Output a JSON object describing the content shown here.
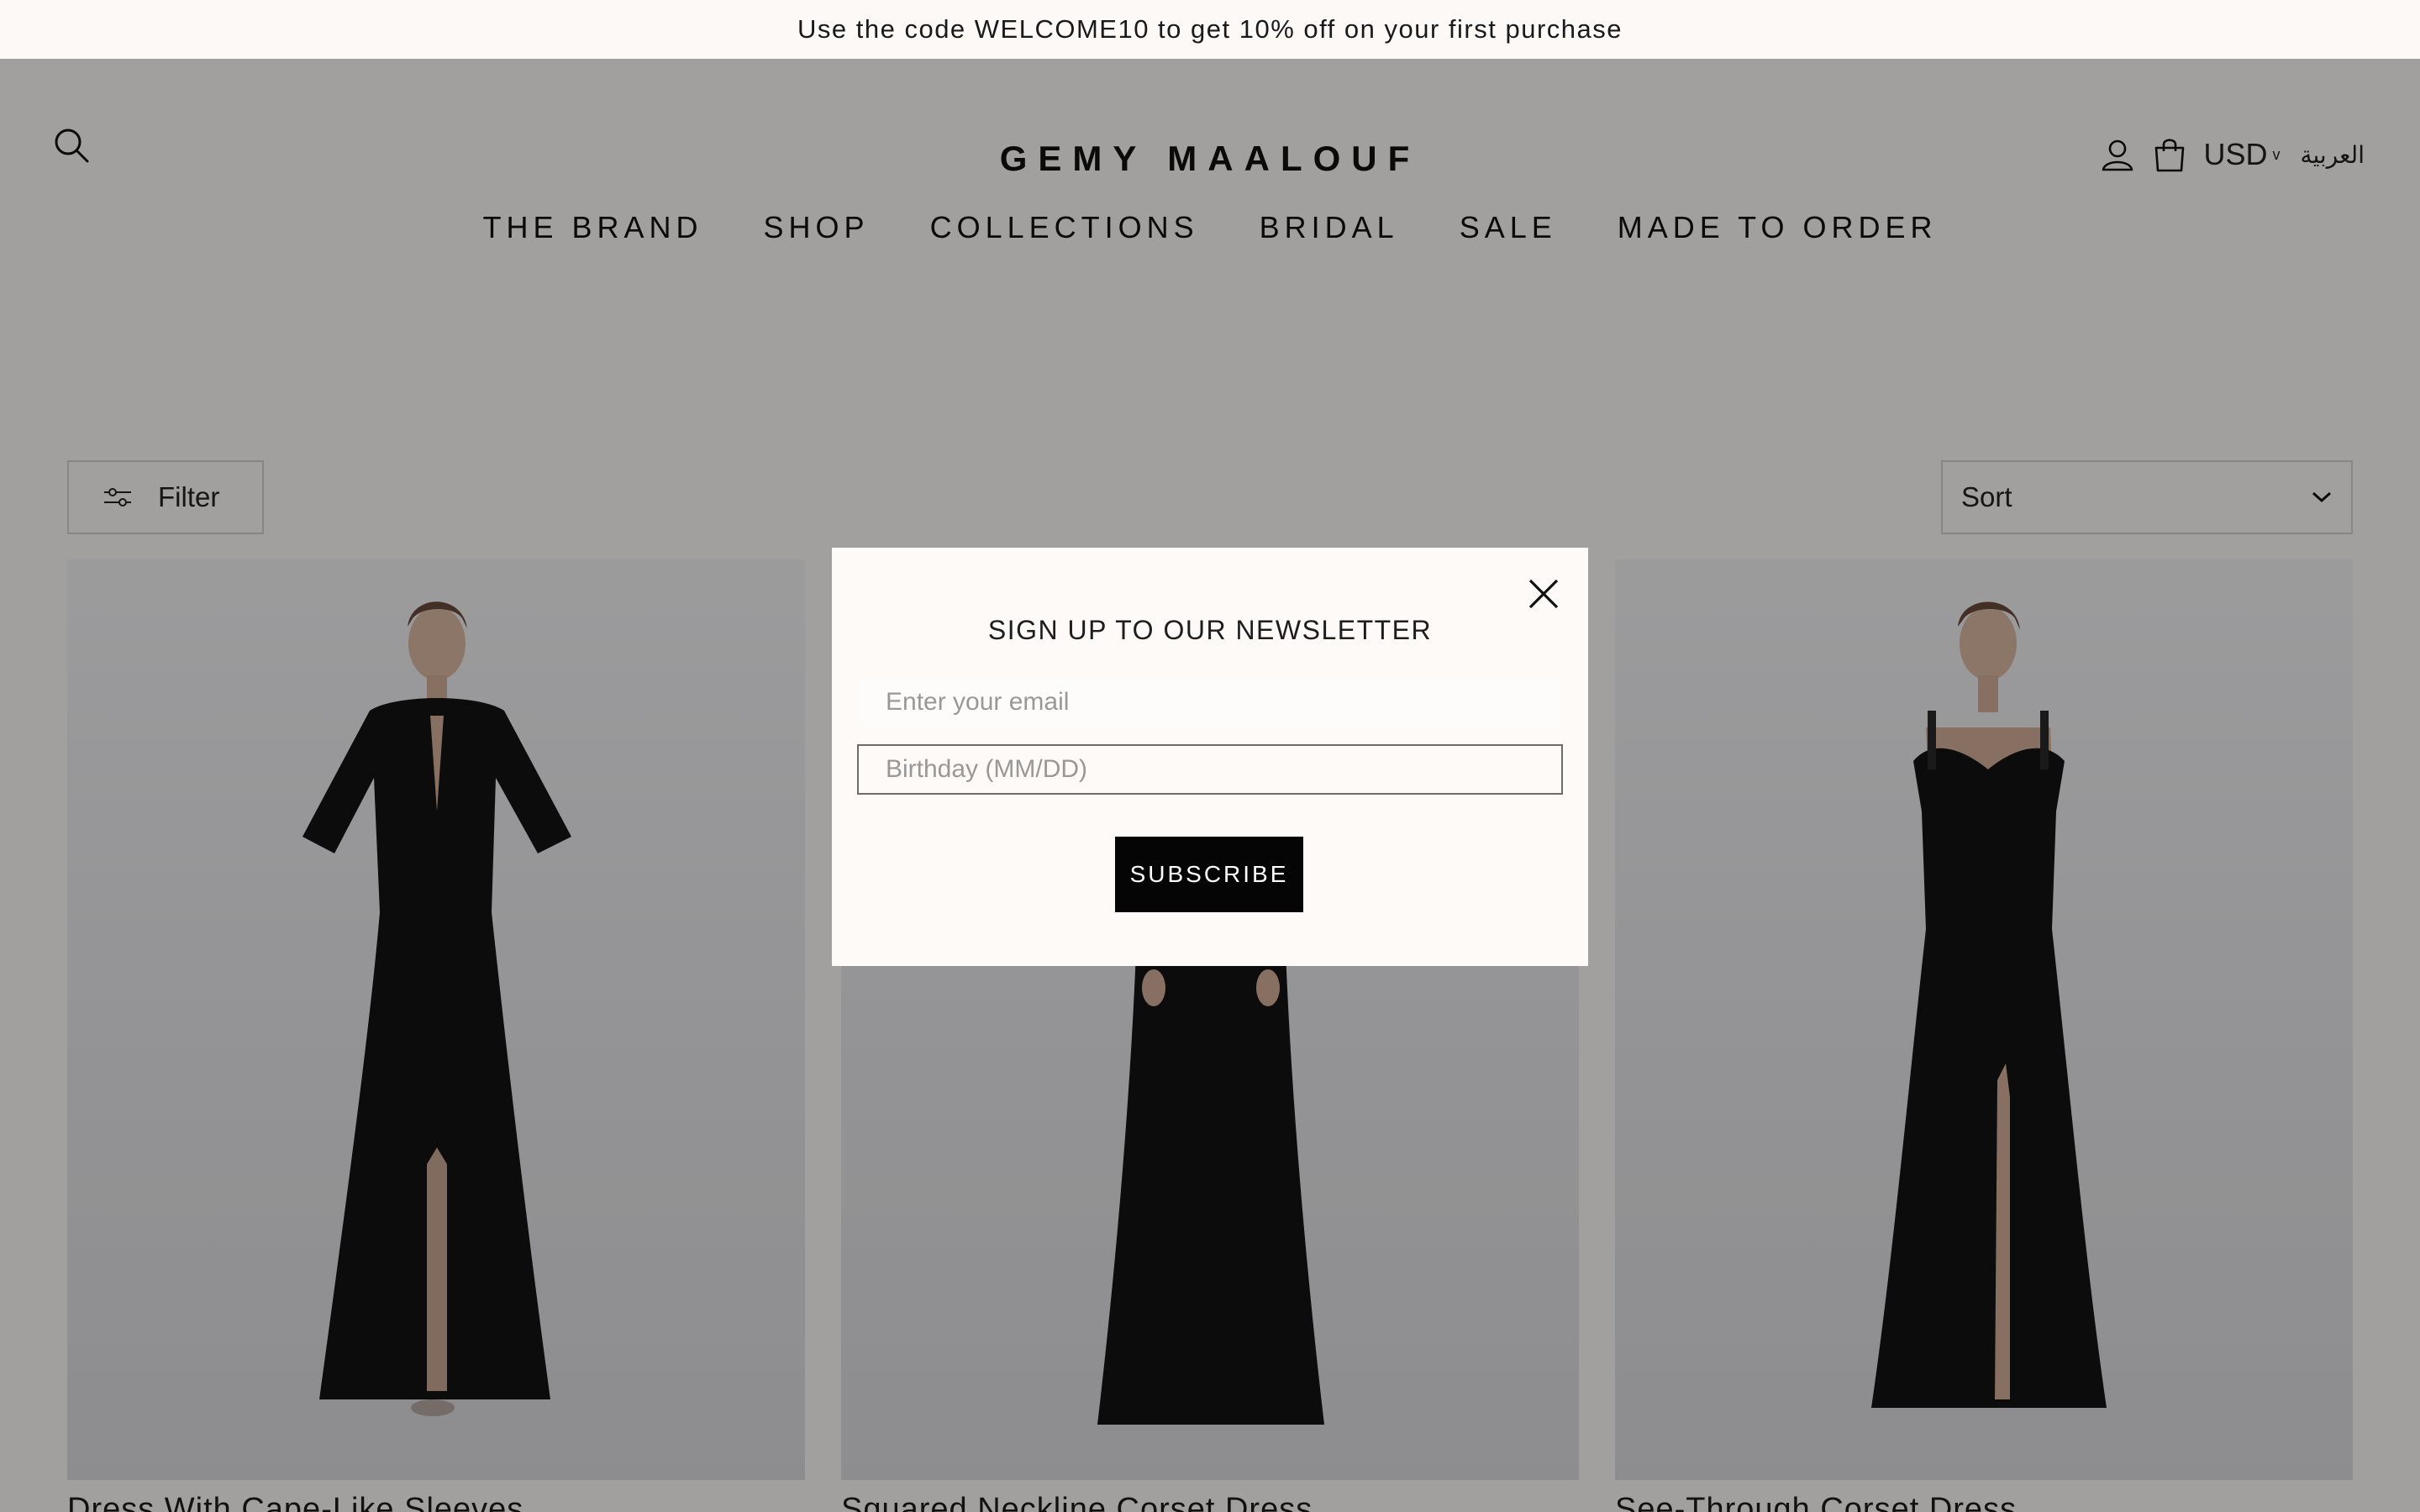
{
  "announcement": {
    "text": "Use the code WELCOME10 to get 10% off on your first purchase"
  },
  "header": {
    "logo": "GEMY MAALOUF",
    "currency": "USD",
    "currency_caret": "v",
    "language": "العربية",
    "icons": [
      "search-icon",
      "account-icon",
      "cart-icon"
    ],
    "nav": [
      "THE BRAND",
      "SHOP",
      "COLLECTIONS",
      "BRIDAL",
      "SALE",
      "MADE TO ORDER"
    ]
  },
  "toolbar": {
    "filter_label": "Filter",
    "sort_label": "Sort"
  },
  "products": [
    {
      "title": "Dress With Cape-Like Sleeves"
    },
    {
      "title": "Squared Neckline Corset Dress"
    },
    {
      "title": "See-Through Corset Dress"
    }
  ],
  "newsletter": {
    "title": "SIGN UP TO OUR NEWSLETTER",
    "email_placeholder": "Enter your email",
    "birthday_placeholder": "Birthday (MM/DD)",
    "subscribe_label": "SUBSCRIBE"
  },
  "colors": {
    "overlay": "#000000",
    "button": "#050505",
    "background": "#fdfaf8",
    "dress": "#141414"
  }
}
